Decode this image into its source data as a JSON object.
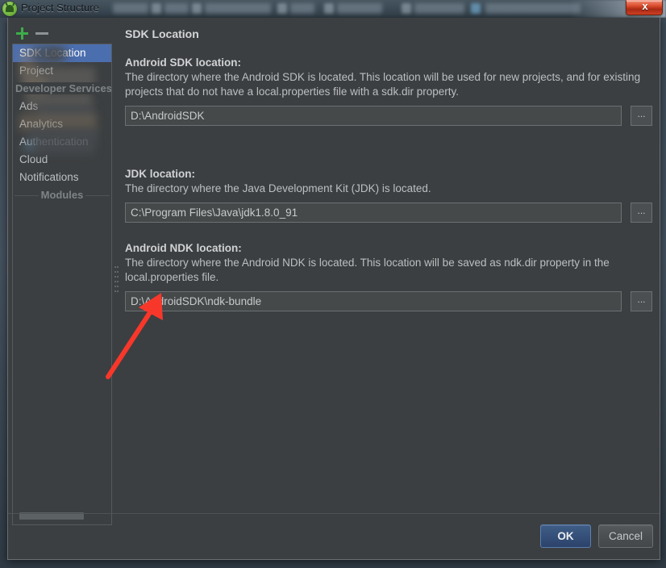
{
  "window": {
    "title": "Project Structure",
    "app_icon": "android-studio-icon",
    "close_label": "x"
  },
  "taskbar": {
    "background_items_blurred": true
  },
  "left_panel": {
    "toolbar": {
      "add_label": "+",
      "remove_label": "−"
    },
    "items": [
      {
        "kind": "item",
        "label": "SDK Location",
        "selected": true
      },
      {
        "kind": "item",
        "label": "Project",
        "selected": false
      },
      {
        "kind": "group",
        "label": "Developer Services"
      },
      {
        "kind": "item",
        "label": "Ads",
        "selected": false
      },
      {
        "kind": "item",
        "label": "Analytics",
        "selected": false
      },
      {
        "kind": "item",
        "label": "Authentication",
        "selected": false
      },
      {
        "kind": "item",
        "label": "Cloud",
        "selected": false
      },
      {
        "kind": "item",
        "label": "Notifications",
        "selected": false
      },
      {
        "kind": "group",
        "label": "Modules"
      }
    ],
    "modules_section_obscured": true
  },
  "content": {
    "panel_title": "SDK Location",
    "fields": [
      {
        "label": "Android SDK location:",
        "description": "The directory where the Android SDK is located. This location will be used for new projects, and for existing projects that do not have a local.properties file with a sdk.dir property.",
        "value": "D:\\AndroidSDK",
        "placeholder": "",
        "browse_label": "..."
      },
      {
        "label": "JDK location:",
        "description": "The directory where the Java Development Kit (JDK) is located.",
        "value": "C:\\Program Files\\Java\\jdk1.8.0_91",
        "placeholder": "",
        "browse_label": "..."
      },
      {
        "label": "Android NDK location:",
        "description": "The directory where the Android NDK is located. This location will be saved as ndk.dir property in the local.properties file.",
        "value": "D:\\AndroidSDK\\ndk-bundle",
        "placeholder": "",
        "browse_label": "..."
      }
    ]
  },
  "annotation": {
    "type": "arrow",
    "color": "#f8372b",
    "points_to": "android-ndk-location-input"
  },
  "footer": {
    "ok_label": "OK",
    "cancel_label": "Cancel"
  },
  "colors": {
    "window_bg": "#3c3f41",
    "selection_blue": "#4b6eaf",
    "input_bg": "#45494a",
    "text_primary": "#bdc0c2",
    "accent_green": "#3cad49",
    "annotation_red": "#f8372b",
    "close_red": "#d94b2b"
  }
}
